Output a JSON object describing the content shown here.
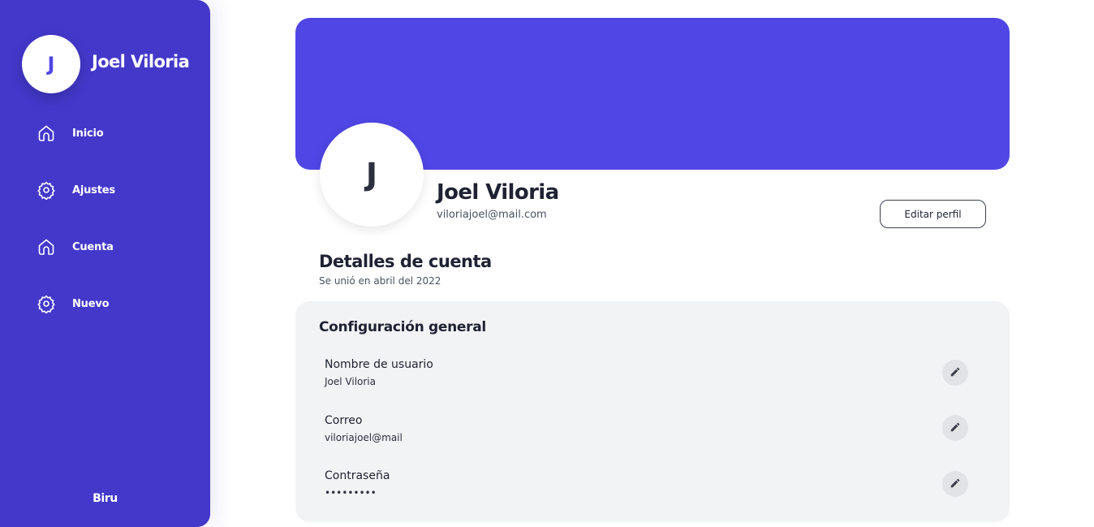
{
  "sidebar": {
    "avatar_initial": "J",
    "user_name": "Joel Viloria",
    "items": [
      {
        "label": "Inicio",
        "icon": "home-icon"
      },
      {
        "label": "Ajustes",
        "icon": "gear-icon"
      },
      {
        "label": "Cuenta",
        "icon": "home-icon"
      },
      {
        "label": "Nuevo",
        "icon": "gear-icon"
      }
    ],
    "footer": "Biru"
  },
  "profile": {
    "avatar_initial": "J",
    "name": "Joel Viloria",
    "email": "viloriajoel@mail.com",
    "edit_button": "Editar perfil"
  },
  "details": {
    "title": "Detalles de cuenta",
    "subtitle": "Se unió en abril del 2022"
  },
  "settings": {
    "title": "Configuración general",
    "rows": [
      {
        "label": "Nombre de usuario",
        "value": "Joel Viloria",
        "icon": "pencil-icon"
      },
      {
        "label": "Correo",
        "value": "viloriajoel@mail",
        "icon": "pencil-icon"
      },
      {
        "label": "Contraseña",
        "value": "•••••••••",
        "icon": "pencil-icon"
      }
    ]
  },
  "colors": {
    "sidebar_bg": "#4338ca",
    "banner_bg": "#4f46e5",
    "card_bg": "#f2f3f5"
  }
}
